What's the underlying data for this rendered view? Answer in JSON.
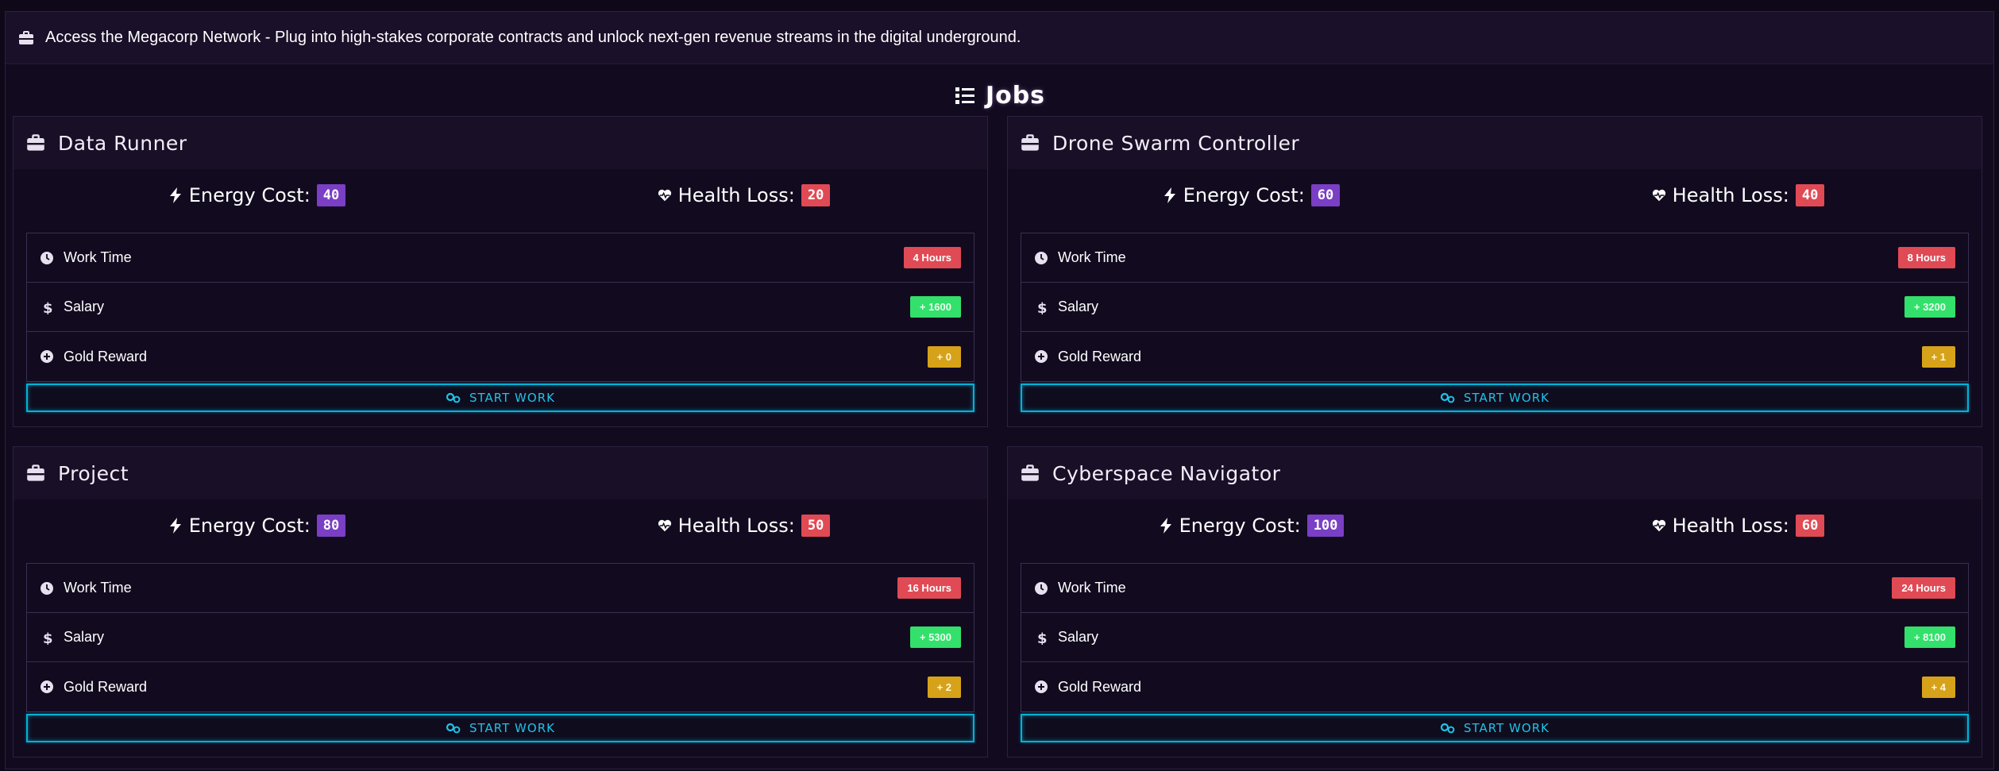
{
  "banner": {
    "text": "Access the Megacorp Network - Plug into high-stakes corporate contracts and unlock next-gen revenue streams in the digital underground."
  },
  "section": {
    "title": "Jobs"
  },
  "labels": {
    "energy_cost": "Energy Cost:",
    "health_loss": "Health Loss:",
    "work_time": "Work Time",
    "salary": "Salary",
    "gold_reward": "Gold Reward",
    "start_work": "START WORK"
  },
  "colors": {
    "energy_badge": "#7a3fc4",
    "health_badge": "#e04a55",
    "time_badge": "#e04a55",
    "salary_badge": "#33e06b",
    "gold_badge": "#d6a21a",
    "button_accent": "#00b3d6"
  },
  "jobs": [
    {
      "name": "Data Runner",
      "energy_cost": "40",
      "health_loss": "20",
      "work_time": "4 Hours",
      "salary": "+ 1600",
      "gold_reward": "+ 0"
    },
    {
      "name": "Drone Swarm Controller",
      "energy_cost": "60",
      "health_loss": "40",
      "work_time": "8 Hours",
      "salary": "+ 3200",
      "gold_reward": "+ 1"
    },
    {
      "name": "Project",
      "energy_cost": "80",
      "health_loss": "50",
      "work_time": "16 Hours",
      "salary": "+ 5300",
      "gold_reward": "+ 2"
    },
    {
      "name": "Cyberspace Navigator",
      "energy_cost": "100",
      "health_loss": "60",
      "work_time": "24 Hours",
      "salary": "+ 8100",
      "gold_reward": "+ 4"
    }
  ]
}
